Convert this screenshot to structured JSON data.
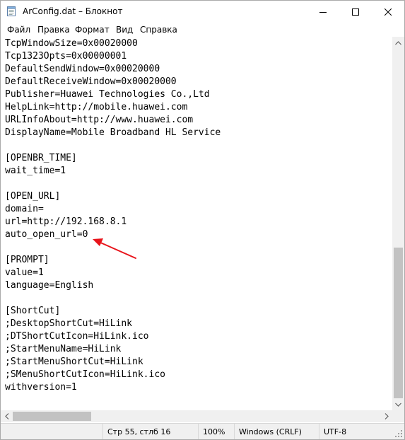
{
  "window": {
    "title": "ArConfig.dat – Блокнот"
  },
  "menu": [
    "Файл",
    "Правка",
    "Формат",
    "Вид",
    "Справка"
  ],
  "editor": {
    "lines": [
      "TcpWindowSize=0x00020000",
      "Tcp1323Opts=0x00000001",
      "DefaultSendWindow=0x00020000",
      "DefaultReceiveWindow=0x00020000",
      "Publisher=Huawei Technologies Co.,Ltd",
      "HelpLink=http://mobile.huawei.com",
      "URLInfoAbout=http://www.huawei.com",
      "DisplayName=Mobile Broadband HL Service",
      "",
      "[OPENBR_TIME]",
      "wait_time=1",
      "",
      "[OPEN_URL]",
      "domain=",
      "url=http://192.168.8.1",
      "auto_open_url=0",
      "",
      "[PROMPT]",
      "value=1",
      "language=English",
      "",
      "[ShortCut]",
      ";DesktopShortCut=HiLink",
      ";DTShortCutIcon=HiLink.ico",
      ";StartMenuName=HiLink",
      ";StartMenuShortCut=HiLink",
      ";SMenuShortCutIcon=HiLink.ico",
      "withversion=1"
    ]
  },
  "status": {
    "position": "Стр 55, стлб 16",
    "zoom": "100%",
    "line_ending": "Windows (CRLF)",
    "encoding": "UTF-8"
  },
  "colors": {
    "annotation_arrow": "#e8141b",
    "scroll_thumb": "#c2c2c2",
    "statusbar_bg": "#f0f0f0"
  }
}
